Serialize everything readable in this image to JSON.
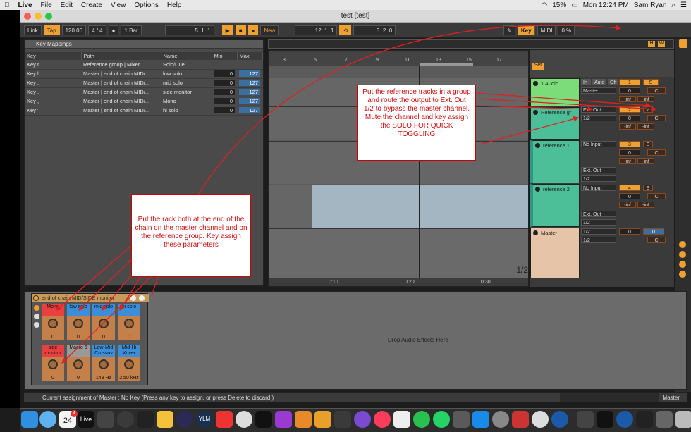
{
  "menubar": {
    "apple": "",
    "app": "Live",
    "items": [
      "File",
      "Edit",
      "Create",
      "View",
      "Options",
      "Help"
    ],
    "battery": "15%",
    "time": "Mon 12:24 PM",
    "user": "Sam Ryan"
  },
  "window": {
    "title": "test  [test]"
  },
  "transport": {
    "link": "Link",
    "tap": "Tap",
    "tempo": "120.00",
    "sig": "4 / 4",
    "quant": "1 Bar",
    "pos": "5.  1.  1",
    "new": "New",
    "loop_start": "12.  1.  1",
    "loop_len": "3.  2.  0",
    "key": "Key",
    "midi": "MIDI",
    "cpu": "0 %"
  },
  "keymap": {
    "title": "Key Mappings",
    "cols": [
      "Key",
      "Path",
      "Name",
      "Min",
      "Max"
    ],
    "rows": [
      {
        "key": "Key r",
        "path": "Reference group | Mixer",
        "name": "Solo/Cue",
        "min": "",
        "max": ""
      },
      {
        "key": "Key l",
        "path": "Master | end of chain MID/...",
        "name": "low solo",
        "min": "0",
        "max": "127"
      },
      {
        "key": "Key ;",
        "path": "Master | end of chain MID/...",
        "name": "mid solo",
        "min": "0",
        "max": "127"
      },
      {
        "key": "Key .",
        "path": "Master | end of chain MID/...",
        "name": "side monitor",
        "min": "0",
        "max": "127"
      },
      {
        "key": "Key ,",
        "path": "Master | end of chain MID/...",
        "name": "Mono",
        "min": "0",
        "max": "127"
      },
      {
        "key": "Key '",
        "path": "Master | end of chain MID/...",
        "name": "hi solo",
        "min": "0",
        "max": "127"
      }
    ]
  },
  "ruler": {
    "bars": [
      "3",
      "5",
      "7",
      "9",
      "11",
      "13",
      "15",
      "17"
    ],
    "times": [
      "0:10",
      "0:20",
      "0:30"
    ],
    "page": "1/2",
    "set": "Set"
  },
  "tracks": [
    {
      "name": "1 Audio",
      "in": "In",
      "auto": "Auto",
      "off": "Off",
      "out": "Master",
      "num": "1",
      "s": "S",
      "vol": "0",
      "pan": "C",
      "l": "-inf",
      "r": "-inf"
    },
    {
      "name": "Reference gr",
      "out": "Ext. Out",
      "ch": "1/2",
      "num": "2",
      "s": "✓",
      "vol": "0",
      "pan": "C",
      "l": "-inf",
      "r": "-inf"
    },
    {
      "name": "reference 1",
      "in": "No Input",
      "out": "Ext. Out",
      "ch": "1/2",
      "num": "3",
      "s": "S",
      "vol": "0",
      "pan": "C",
      "l": "-inf",
      "r": "-inf"
    },
    {
      "name": "reference 2",
      "in": "No Input",
      "out": "Ext. Out",
      "ch": "1/2",
      "num": "4",
      "s": "S",
      "vol": "0",
      "pan": "C",
      "l": "-inf",
      "r": "-inf"
    },
    {
      "name": "Master",
      "ch": "1/2",
      "out": "1/2",
      "vol": "0",
      "vol2": "0",
      "pan": "C"
    }
  ],
  "notes": {
    "note1": "Put the reference tracks in a group and route the output to Ext. Out 1/2 to bypass the master channel. Mute the channel and key assign the SOLO FOR QUICK TOGGLING",
    "note2": "Put the rack both at the end of the chain on the master channel and on the reference group. Key assign these parameters"
  },
  "rack": {
    "title": "end of chain MID/SIDE  monitor",
    "macros": [
      {
        "label": "Mono",
        "val": "0",
        "color": "#e84040"
      },
      {
        "label": "low solo",
        "val": "0",
        "color": "#3a8fd8"
      },
      {
        "label": "mid solo",
        "val": "0",
        "color": "#3a8fd8"
      },
      {
        "label": "hi solo",
        "val": "0",
        "color": "#3a8fd8"
      },
      {
        "label": "side monitor",
        "val": "0",
        "color": "#e84040"
      },
      {
        "label": "Macro 6",
        "val": "0",
        "color": "#9a9a9a"
      },
      {
        "label": "Low-Mid Crossov",
        "val": "143 Hz",
        "color": "#3a8fd8"
      },
      {
        "label": "Mid-Hi Xover",
        "val": "2.50 kHz",
        "color": "#3a8fd8"
      }
    ]
  },
  "devices": {
    "drop": "Drop Audio Effects Here"
  },
  "status": {
    "text": "Current assignment of Master :  No Key  (Press any key to assign, or press Delete to discard.)",
    "track": "Master"
  },
  "dock": {
    "date": "24",
    "badge": "4",
    "live": "Live",
    "ylm": "YLM"
  },
  "colors": {
    "accent": "#f0a030",
    "audio": "#7ddc7a",
    "group": "#4cbf98",
    "master": "#e5c4a8",
    "annot": "#d01010"
  }
}
